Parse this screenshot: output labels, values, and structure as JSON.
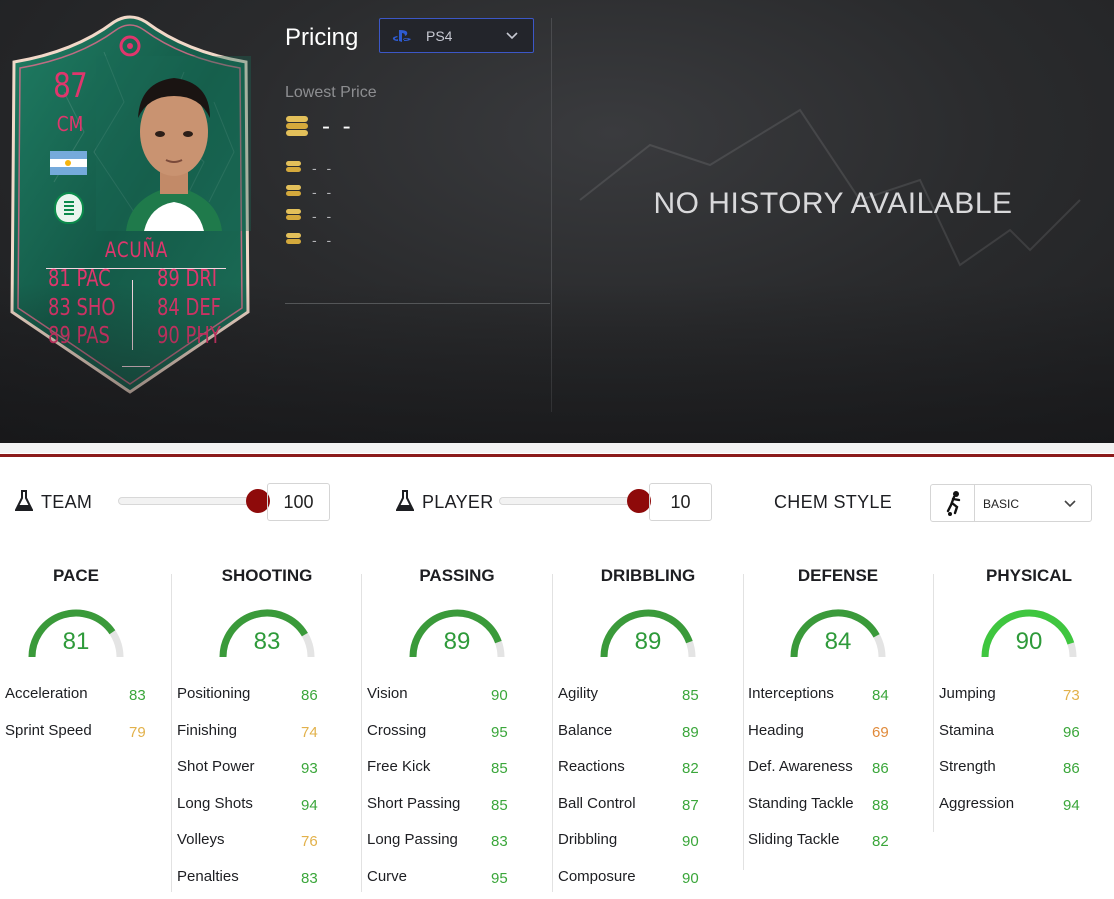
{
  "card": {
    "rating": "87",
    "position": "CM",
    "name": "ACUÑA",
    "stats": [
      {
        "text": "81 PAC"
      },
      {
        "text": "83 SHO"
      },
      {
        "text": "89 PAS"
      },
      {
        "text": "89 DRI"
      },
      {
        "text": "84 DEF"
      },
      {
        "text": "90 PHY"
      }
    ],
    "nation": "Argentina",
    "club": "Sporting CP",
    "accent_color": "#e0366d",
    "frame_color": "#1b6b56"
  },
  "pricing": {
    "title": "Pricing",
    "platform": "PS4",
    "lowest_label": "Lowest Price",
    "lowest_value": "- -",
    "other_prices": [
      "- -",
      "- -",
      "- -",
      "- -"
    ],
    "history_message": "NO HISTORY AVAILABLE"
  },
  "chemistry": {
    "team_label": "TEAM",
    "team_value": "100",
    "team_fraction": 1.0,
    "player_label": "PLAYER",
    "player_value": "10",
    "player_fraction": 1.0,
    "chem_style_label": "CHEM STYLE",
    "chem_style_value": "BASIC",
    "knob_color": "#8e0a0a"
  },
  "attributes": [
    {
      "name": "PACE",
      "value": "81",
      "score": 81,
      "items": [
        {
          "label": "Acceleration",
          "value": "83",
          "tier": "high"
        },
        {
          "label": "Sprint Speed",
          "value": "79",
          "tier": "med"
        }
      ]
    },
    {
      "name": "SHOOTING",
      "value": "83",
      "score": 83,
      "items": [
        {
          "label": "Positioning",
          "value": "86",
          "tier": "high"
        },
        {
          "label": "Finishing",
          "value": "74",
          "tier": "med"
        },
        {
          "label": "Shot Power",
          "value": "93",
          "tier": "high"
        },
        {
          "label": "Long Shots",
          "value": "94",
          "tier": "high"
        },
        {
          "label": "Volleys",
          "value": "76",
          "tier": "med"
        },
        {
          "label": "Penalties",
          "value": "83",
          "tier": "high"
        }
      ]
    },
    {
      "name": "PASSING",
      "value": "89",
      "score": 89,
      "items": [
        {
          "label": "Vision",
          "value": "90",
          "tier": "high"
        },
        {
          "label": "Crossing",
          "value": "95",
          "tier": "high"
        },
        {
          "label": "Free Kick",
          "value": "85",
          "tier": "high"
        },
        {
          "label": "Short Passing",
          "value": "85",
          "tier": "high"
        },
        {
          "label": "Long Passing",
          "value": "83",
          "tier": "high"
        },
        {
          "label": "Curve",
          "value": "95",
          "tier": "high"
        }
      ]
    },
    {
      "name": "DRIBBLING",
      "value": "89",
      "score": 89,
      "items": [
        {
          "label": "Agility",
          "value": "85",
          "tier": "high"
        },
        {
          "label": "Balance",
          "value": "89",
          "tier": "high"
        },
        {
          "label": "Reactions",
          "value": "82",
          "tier": "high"
        },
        {
          "label": "Ball Control",
          "value": "87",
          "tier": "high"
        },
        {
          "label": "Dribbling",
          "value": "90",
          "tier": "high"
        },
        {
          "label": "Composure",
          "value": "90",
          "tier": "high"
        }
      ]
    },
    {
      "name": "DEFENSE",
      "value": "84",
      "score": 84,
      "items": [
        {
          "label": "Interceptions",
          "value": "84",
          "tier": "high"
        },
        {
          "label": "Heading",
          "value": "69",
          "tier": "low"
        },
        {
          "label": "Def. Awareness",
          "value": "86",
          "tier": "high"
        },
        {
          "label": "Standing Tackle",
          "value": "88",
          "tier": "high"
        },
        {
          "label": "Sliding Tackle",
          "value": "82",
          "tier": "high"
        }
      ]
    },
    {
      "name": "PHYSICAL",
      "value": "90",
      "score": 90,
      "items": [
        {
          "label": "Jumping",
          "value": "73",
          "tier": "med"
        },
        {
          "label": "Stamina",
          "value": "96",
          "tier": "high"
        },
        {
          "label": "Strength",
          "value": "86",
          "tier": "high"
        },
        {
          "label": "Aggression",
          "value": "94",
          "tier": "high"
        }
      ]
    }
  ],
  "colors": {
    "high": "#3aa63a",
    "med": "#e2b14a",
    "low": "#e08a3a",
    "gauge_bright": "#3fc63f",
    "gauge_dark": "#3a9a3a",
    "gauge_track": "#e4e4e4",
    "divider": "#8b1a1a"
  }
}
